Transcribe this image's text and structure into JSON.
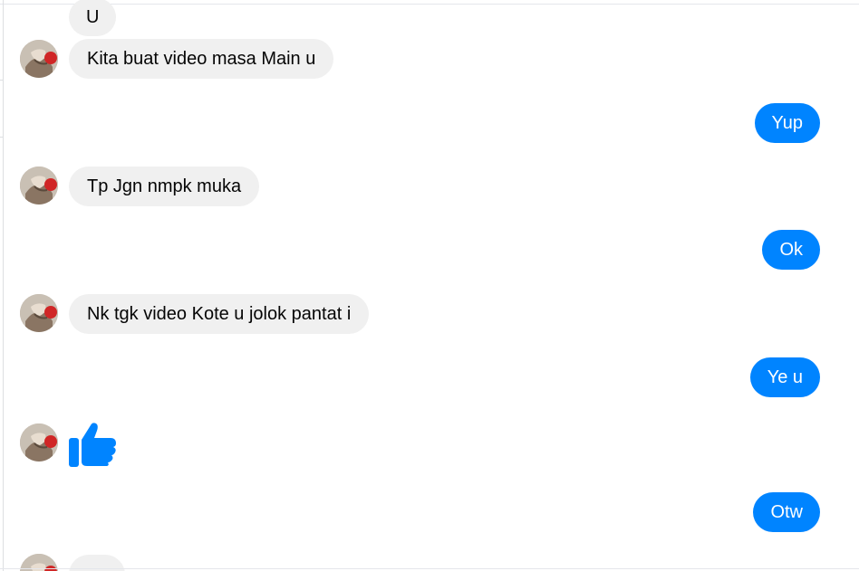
{
  "conversation": {
    "messages": [
      {
        "from": "other",
        "text": "U"
      },
      {
        "from": "other",
        "text": "Kita buat video masa Main u"
      },
      {
        "from": "me",
        "text": "Yup"
      },
      {
        "from": "other",
        "text": "Tp Jgn nmpk muka"
      },
      {
        "from": "me",
        "text": "Ok"
      },
      {
        "from": "other",
        "text": "Nk tgk video Kote u jolok pantat i"
      },
      {
        "from": "me",
        "text": "Ye u"
      },
      {
        "from": "other",
        "icon": "thumbs-up-icon"
      },
      {
        "from": "me",
        "text": "Otw"
      }
    ]
  },
  "colors": {
    "outgoing_bubble": "#0084ff",
    "incoming_bubble": "#f0f0f0",
    "thumbs_up": "#0084ff"
  }
}
